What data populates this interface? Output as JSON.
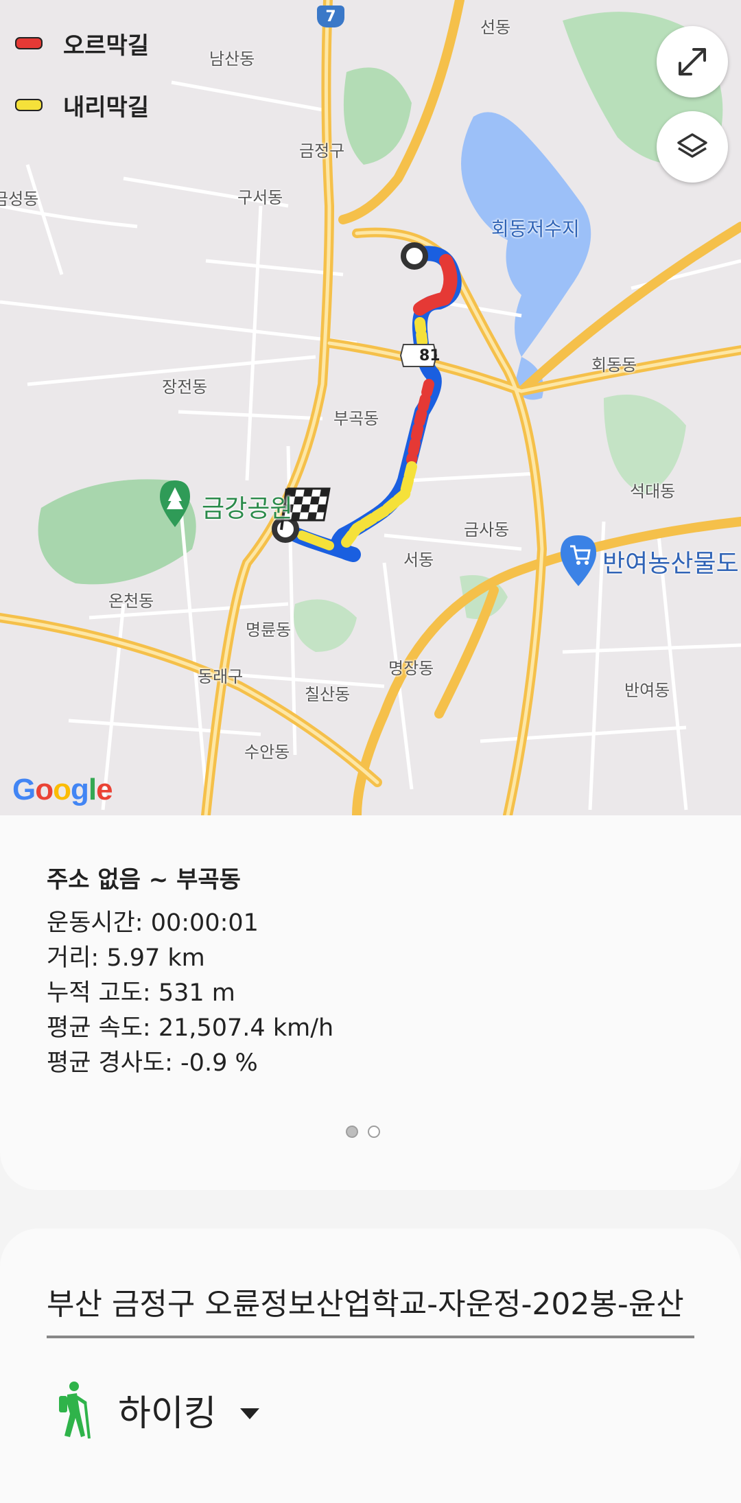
{
  "map": {
    "legend": [
      {
        "label": "오르막길",
        "color": "#e53935"
      },
      {
        "label": "내리막길",
        "color": "#f5e13a"
      }
    ],
    "route_colors": {
      "uphill": "#e53935",
      "downhill": "#f5e13a",
      "flat": "#1a5fe0"
    },
    "place_labels": {
      "seondong": "선동",
      "namsandong": "남산동",
      "geumjeonggu": "금정구",
      "geumseongdong": "금성동",
      "guseodong": "구서동",
      "hoedongreservoir": "회동저수지",
      "hoedongdong": "회동동",
      "jangjeondong": "장전동",
      "bugokdong": "부곡동",
      "seokdaedong": "석대동",
      "geumgangpark": "금강공원",
      "geumsadong": "금사동",
      "seodong": "서동",
      "banyeomarket": "반여농산물도",
      "oncheondong": "온천동",
      "myeongnyundong": "명륜동",
      "dongnaegu": "동래구",
      "myeongjangdong": "명장동",
      "chilsandong": "칠산동",
      "banyeodong": "반여동",
      "suandong": "수안동"
    },
    "route_shield_81": "81",
    "route_shield_7": "7",
    "google": [
      "G",
      "o",
      "o",
      "g",
      "l",
      "e"
    ]
  },
  "summary": {
    "title": "주소 없음 ~ 부곡동",
    "stats": [
      "운동시간: 00:00:01",
      "거리: 5.97 km",
      "누적 고도: 531 m",
      "평균 속도: 21,507.4 km/h",
      "평균 경사도: -0.9 %"
    ],
    "page_index": 1,
    "page_count": 2
  },
  "record": {
    "name": "부산 금정구 오륜정보산업학교-자운정-202봉-윤산",
    "activity": "하이킹"
  }
}
